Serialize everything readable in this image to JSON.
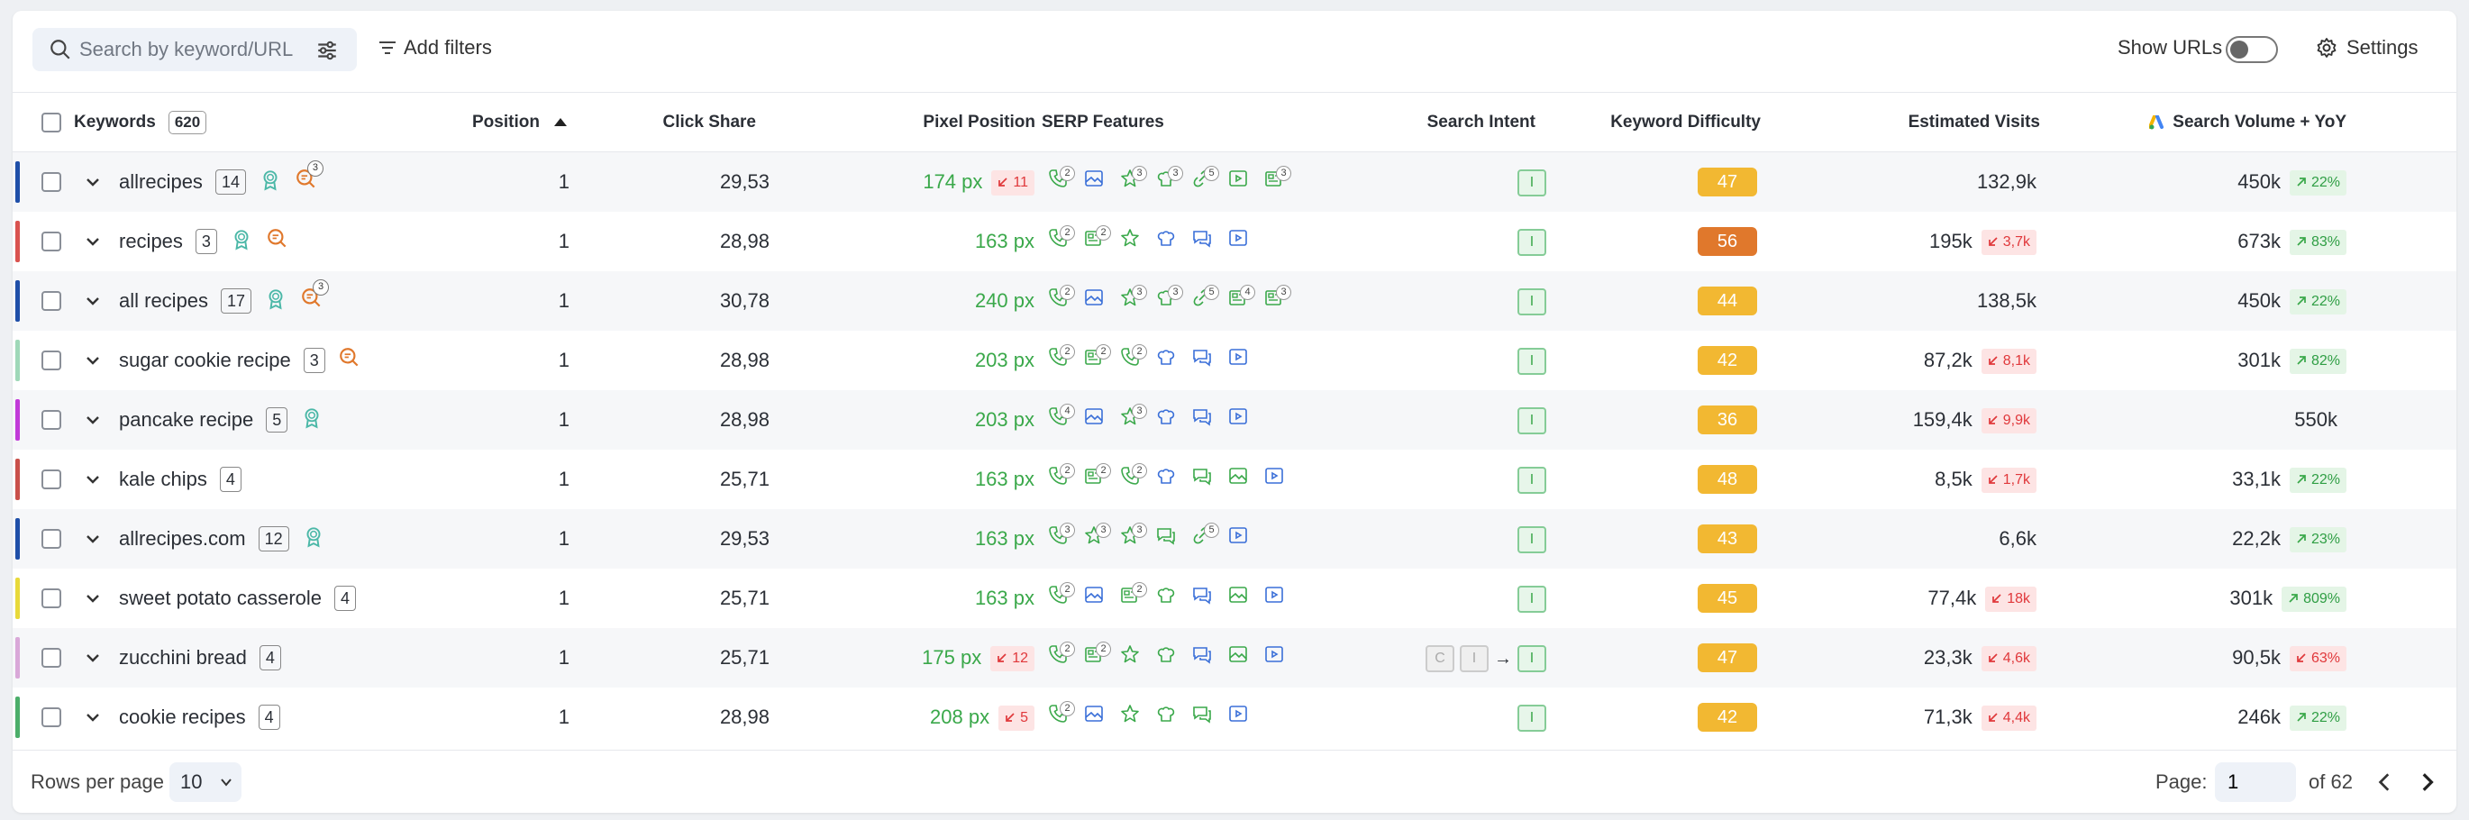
{
  "toolbar": {
    "search_placeholder": "Search by keyword/URL",
    "add_filters_label": "Add filters",
    "show_urls_label": "Show URLs",
    "show_urls_on": false,
    "settings_label": "Settings"
  },
  "table": {
    "headers": {
      "keywords": "Keywords",
      "keyword_count": "620",
      "position": "Position",
      "click_share": "Click Share",
      "pixel_position": "Pixel Position",
      "serp_features": "SERP Features",
      "search_intent": "Search Intent",
      "keyword_difficulty": "Keyword Difficulty",
      "estimated_visits": "Estimated Visits",
      "search_volume": "Search Volume + YoY"
    },
    "rows": [
      {
        "keyword": "allrecipes",
        "count": "14",
        "position": "1",
        "click_share": "29,53",
        "pixel": "174 px",
        "pixel_delta": "11",
        "intent": "I",
        "kd": "47",
        "visits": "132,9k",
        "visits_delta": "",
        "volume": "450k",
        "yoy": "22%",
        "yoy_dir": "up",
        "strip": "#1f4fa8"
      },
      {
        "keyword": "recipes",
        "count": "3",
        "position": "1",
        "click_share": "28,98",
        "pixel": "163 px",
        "pixel_delta": "",
        "intent": "I",
        "kd": "56",
        "visits": "195k",
        "visits_delta": "3,7k",
        "volume": "673k",
        "yoy": "83%",
        "yoy_dir": "up",
        "strip": "#d9534f"
      },
      {
        "keyword": "all recipes",
        "count": "17",
        "position": "1",
        "click_share": "30,78",
        "pixel": "240 px",
        "pixel_delta": "",
        "intent": "I",
        "kd": "44",
        "visits": "138,5k",
        "visits_delta": "",
        "volume": "450k",
        "yoy": "22%",
        "yoy_dir": "up",
        "strip": "#1f4fa8"
      },
      {
        "keyword": "sugar cookie recipe",
        "count": "3",
        "position": "1",
        "click_share": "28,98",
        "pixel": "203 px",
        "pixel_delta": "",
        "intent": "I",
        "kd": "42",
        "visits": "87,2k",
        "visits_delta": "8,1k",
        "volume": "301k",
        "yoy": "82%",
        "yoy_dir": "up",
        "strip": "#9fd8b8"
      },
      {
        "keyword": "pancake recipe",
        "count": "5",
        "position": "1",
        "click_share": "28,98",
        "pixel": "203 px",
        "pixel_delta": "",
        "intent": "I",
        "kd": "36",
        "visits": "159,4k",
        "visits_delta": "9,9k",
        "volume": "550k",
        "yoy": "",
        "yoy_dir": "",
        "strip": "#c13ad8"
      },
      {
        "keyword": "kale chips",
        "count": "4",
        "position": "1",
        "click_share": "25,71",
        "pixel": "163 px",
        "pixel_delta": "",
        "intent": "I",
        "kd": "48",
        "visits": "8,5k",
        "visits_delta": "1,7k",
        "volume": "33,1k",
        "yoy": "22%",
        "yoy_dir": "up",
        "strip": "#c9504a"
      },
      {
        "keyword": "allrecipes.com",
        "count": "12",
        "position": "1",
        "click_share": "29,53",
        "pixel": "163 px",
        "pixel_delta": "",
        "intent": "I",
        "kd": "43",
        "visits": "6,6k",
        "visits_delta": "",
        "volume": "22,2k",
        "yoy": "23%",
        "yoy_dir": "up",
        "strip": "#1f4fa8"
      },
      {
        "keyword": "sweet potato casserole",
        "count": "4",
        "position": "1",
        "click_share": "25,71",
        "pixel": "163 px",
        "pixel_delta": "",
        "intent": "I",
        "kd": "45",
        "visits": "77,4k",
        "visits_delta": "18k",
        "volume": "301k",
        "yoy": "809%",
        "yoy_dir": "up",
        "strip": "#e8d93a"
      },
      {
        "keyword": "zucchini bread",
        "count": "4",
        "position": "1",
        "click_share": "25,71",
        "pixel": "175 px",
        "pixel_delta": "12",
        "intent": "I",
        "intent_prev": [
          "C",
          "I"
        ],
        "kd": "47",
        "visits": "23,3k",
        "visits_delta": "4,6k",
        "volume": "90,5k",
        "yoy": "63%",
        "yoy_dir": "down",
        "strip": "#d9a8d8"
      },
      {
        "keyword": "cookie recipes",
        "count": "4",
        "position": "1",
        "click_share": "28,98",
        "pixel": "208 px",
        "pixel_delta": "5",
        "intent": "I",
        "kd": "42",
        "visits": "71,3k",
        "visits_delta": "4,4k",
        "volume": "246k",
        "yoy": "22%",
        "yoy_dir": "up",
        "strip": "#4cae6a"
      }
    ]
  },
  "footer": {
    "rows_per_page_label": "Rows per page",
    "rows_per_page_value": "10",
    "page_label": "Page:",
    "page_value": "1",
    "of_label": "of",
    "total_pages": "62"
  },
  "colors": {
    "kd_yellow": "#f2b832",
    "kd_orange": "#e0782c",
    "positive": "#3aa84a",
    "negative": "#e0383b"
  }
}
